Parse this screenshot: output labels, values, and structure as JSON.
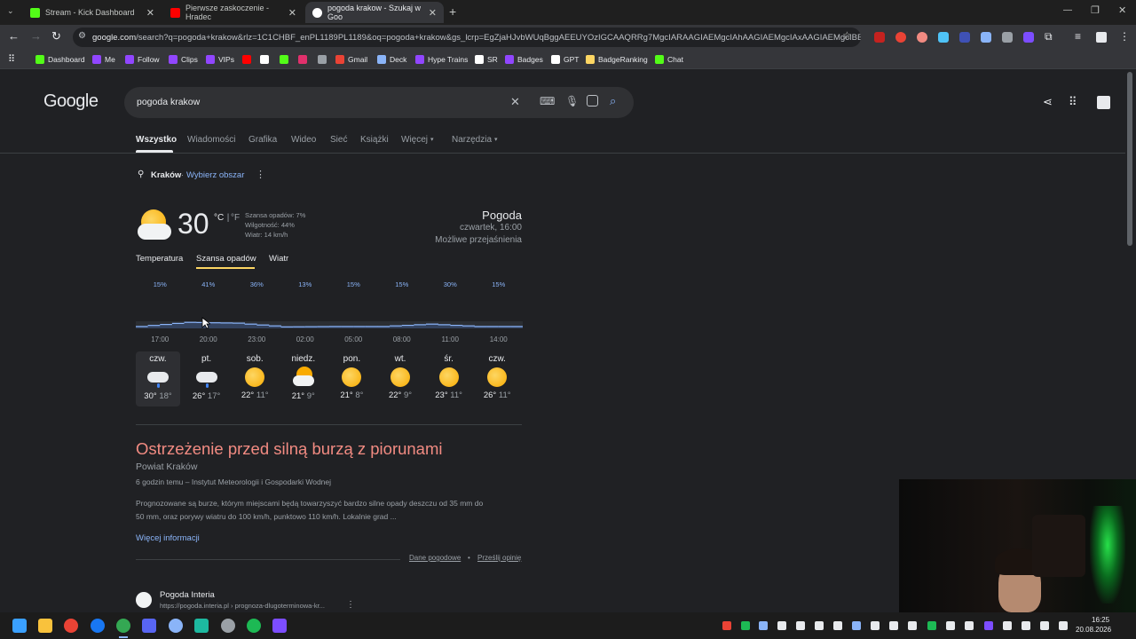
{
  "tabs": [
    {
      "title": "Stream - Kick Dashboard",
      "favicon_color": "#53fc18"
    },
    {
      "title": "Pierwsze zaskoczenie - Hradec",
      "favicon_color": "#ff0000"
    },
    {
      "title": "pogoda krakow - Szukaj w Goo",
      "favicon_color": "#8ab4f8"
    }
  ],
  "url": {
    "host": "google.com",
    "path": "/search?q=pogoda+krakow&rlz=1C1CHBF_enPL1189PL1189&oq=pogoda+krakow&gs_lcrp=EgZjaHJvbWUqBggAEEUYOzIGCAAQRRg7MgcIARAAGIAEMgcIAhAAGIAEMgcIAxAAGIAEMgcIBB..."
  },
  "bookmarks": [
    {
      "label": "Dashboard",
      "color": "#53fc18"
    },
    {
      "label": "Me",
      "color": "#9146ff"
    },
    {
      "label": "Follow",
      "color": "#9146ff"
    },
    {
      "label": "Clips",
      "color": "#9146ff"
    },
    {
      "label": "VIPs",
      "color": "#9146ff"
    },
    {
      "label": "",
      "color": "#ff0000"
    },
    {
      "label": "",
      "color": "#ffffff"
    },
    {
      "label": "",
      "color": "#53fc18"
    },
    {
      "label": "",
      "color": "#e1306c"
    },
    {
      "label": "",
      "color": "#9aa0a6"
    },
    {
      "label": "Gmail",
      "color": "#ea4335"
    },
    {
      "label": "Deck",
      "color": "#8ab4f8"
    },
    {
      "label": "Hype Trains",
      "color": "#9146ff"
    },
    {
      "label": "SR",
      "color": "#ffffff"
    },
    {
      "label": "Badges",
      "color": "#9146ff"
    },
    {
      "label": "GPT",
      "color": "#ffffff"
    },
    {
      "label": "BadgeRanking",
      "color": "#fdd663"
    },
    {
      "label": "Chat",
      "color": "#53fc18"
    }
  ],
  "search": {
    "logo": "Google",
    "query": "pogoda krakow"
  },
  "nav": [
    "Wszystko",
    "Wiadomości",
    "Grafika",
    "Wideo",
    "Sieć",
    "Książki",
    "Więcej",
    "Narzędzia"
  ],
  "location": {
    "city": "Kraków",
    "sep": "·",
    "choose": "Wybierz obszar"
  },
  "weather": {
    "temp": "30",
    "unit_c": "°C",
    "unit_sep": " | ",
    "unit_f": "°F",
    "precip": "Szansa opadów: 7%",
    "humidity": "Wilgotność: 44%",
    "wind": "Wiatr: 14 km/h",
    "title": "Pogoda",
    "time": "czwartek, 16:00",
    "cond": "Możliwe przejaśnienia"
  },
  "weather_tabs": [
    "Temperatura",
    "Szansa opadów",
    "Wiatr"
  ],
  "chart_data": {
    "type": "area",
    "x": [
      "17:00",
      "20:00",
      "23:00",
      "02:00",
      "05:00",
      "08:00",
      "11:00",
      "14:00"
    ],
    "labels": [
      "15%",
      "41%",
      "36%",
      "13%",
      "15%",
      "15%",
      "30%",
      "15%"
    ],
    "values": [
      15,
      41,
      36,
      13,
      15,
      15,
      30,
      15
    ],
    "ylim": [
      0,
      100
    ]
  },
  "forecast": [
    {
      "day": "czw.",
      "hi": "30°",
      "lo": "18°",
      "icon": "rain-cloud-icon"
    },
    {
      "day": "pt.",
      "hi": "26°",
      "lo": "17°",
      "icon": "rain-cloud-icon"
    },
    {
      "day": "sob.",
      "hi": "22°",
      "lo": "11°",
      "icon": "sun-icon"
    },
    {
      "day": "niedz.",
      "hi": "21°",
      "lo": "9°",
      "icon": "partly-cloudy-icon"
    },
    {
      "day": "pon.",
      "hi": "21°",
      "lo": "8°",
      "icon": "sun-icon"
    },
    {
      "day": "wt.",
      "hi": "22°",
      "lo": "9°",
      "icon": "sun-icon"
    },
    {
      "day": "śr.",
      "hi": "23°",
      "lo": "11°",
      "icon": "sun-icon"
    },
    {
      "day": "czw.",
      "hi": "26°",
      "lo": "11°",
      "icon": "sun-icon"
    }
  ],
  "alert": {
    "title": "Ostrzeżenie przed silną burzą z piorunami",
    "area": "Powiat Kraków",
    "source": "6 godzin temu – Instytut Meteorologii i Gospodarki Wodnej",
    "body1": "Prognozowane są burze, którym miejscami będą towarzyszyć bardzo silne opady deszczu od 35 mm do",
    "body2": "50 mm, oraz porywy wiatru do 100 km/h, punktowo 110 km/h. Lokalnie grad ...",
    "more": "Więcej informacji",
    "data_link": "Dane pogodowe",
    "bullet": "•",
    "feedback": "Prześlij opinię",
    "color": "#f28b82"
  },
  "result": {
    "site": "Pogoda Interia",
    "url": "https://pogoda.interia.pl › prognoza-dlugoterminowa-kr..."
  },
  "clock": {
    "time": "16:25",
    "date": "20.08.2026"
  }
}
